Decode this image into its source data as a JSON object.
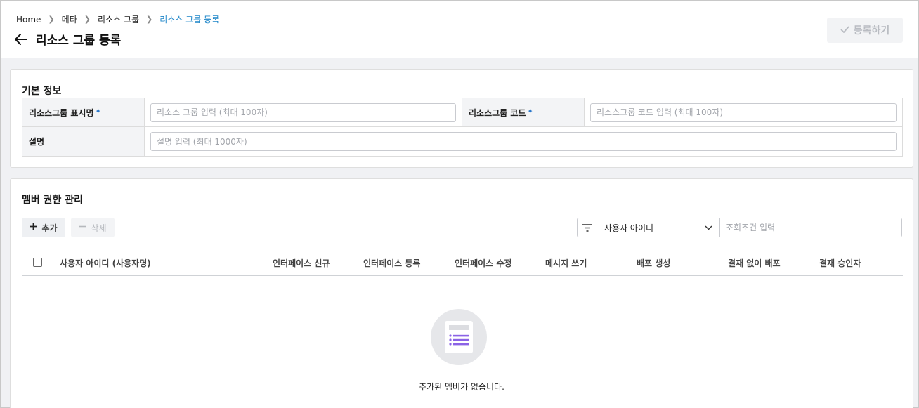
{
  "breadcrumb": {
    "home": "Home",
    "meta": "메타",
    "resource_group": "리소스 그룹",
    "current": "리소스 그룹 등록"
  },
  "header": {
    "title": "리소스 그룹 등록",
    "register_label": "등록하기"
  },
  "basic_info": {
    "title": "기본 정보",
    "display_name_label": "리소스그룹 표시명",
    "display_name_placeholder": "리소스 그룹 입력 (최대 100자)",
    "code_label": "리소스그룹 코드",
    "code_placeholder": "리소스그룹 코드 입력 (최대 100자)",
    "required_mark": "*",
    "desc_label": "설명",
    "desc_placeholder": "설명 입력 (최대 1000자)"
  },
  "members": {
    "title": "멤버 권한 관리",
    "add_label": "추가",
    "delete_label": "삭제",
    "filter_selected": "사용자 아이디",
    "search_placeholder": "조회조건 입력",
    "columns": [
      "사용자 아이디 (사용자명)",
      "인터페이스 신규",
      "인터페이스 등록",
      "인터페이스 수정",
      "메시지 쓰기",
      "배포 생성",
      "결재 없이 배포",
      "결재 승인자"
    ],
    "empty_message": "추가된 멤버가 없습니다."
  },
  "colors": {
    "accent": "#1b84c8",
    "required": "#1b6fc8",
    "empty_icon": "#8b63e6"
  }
}
